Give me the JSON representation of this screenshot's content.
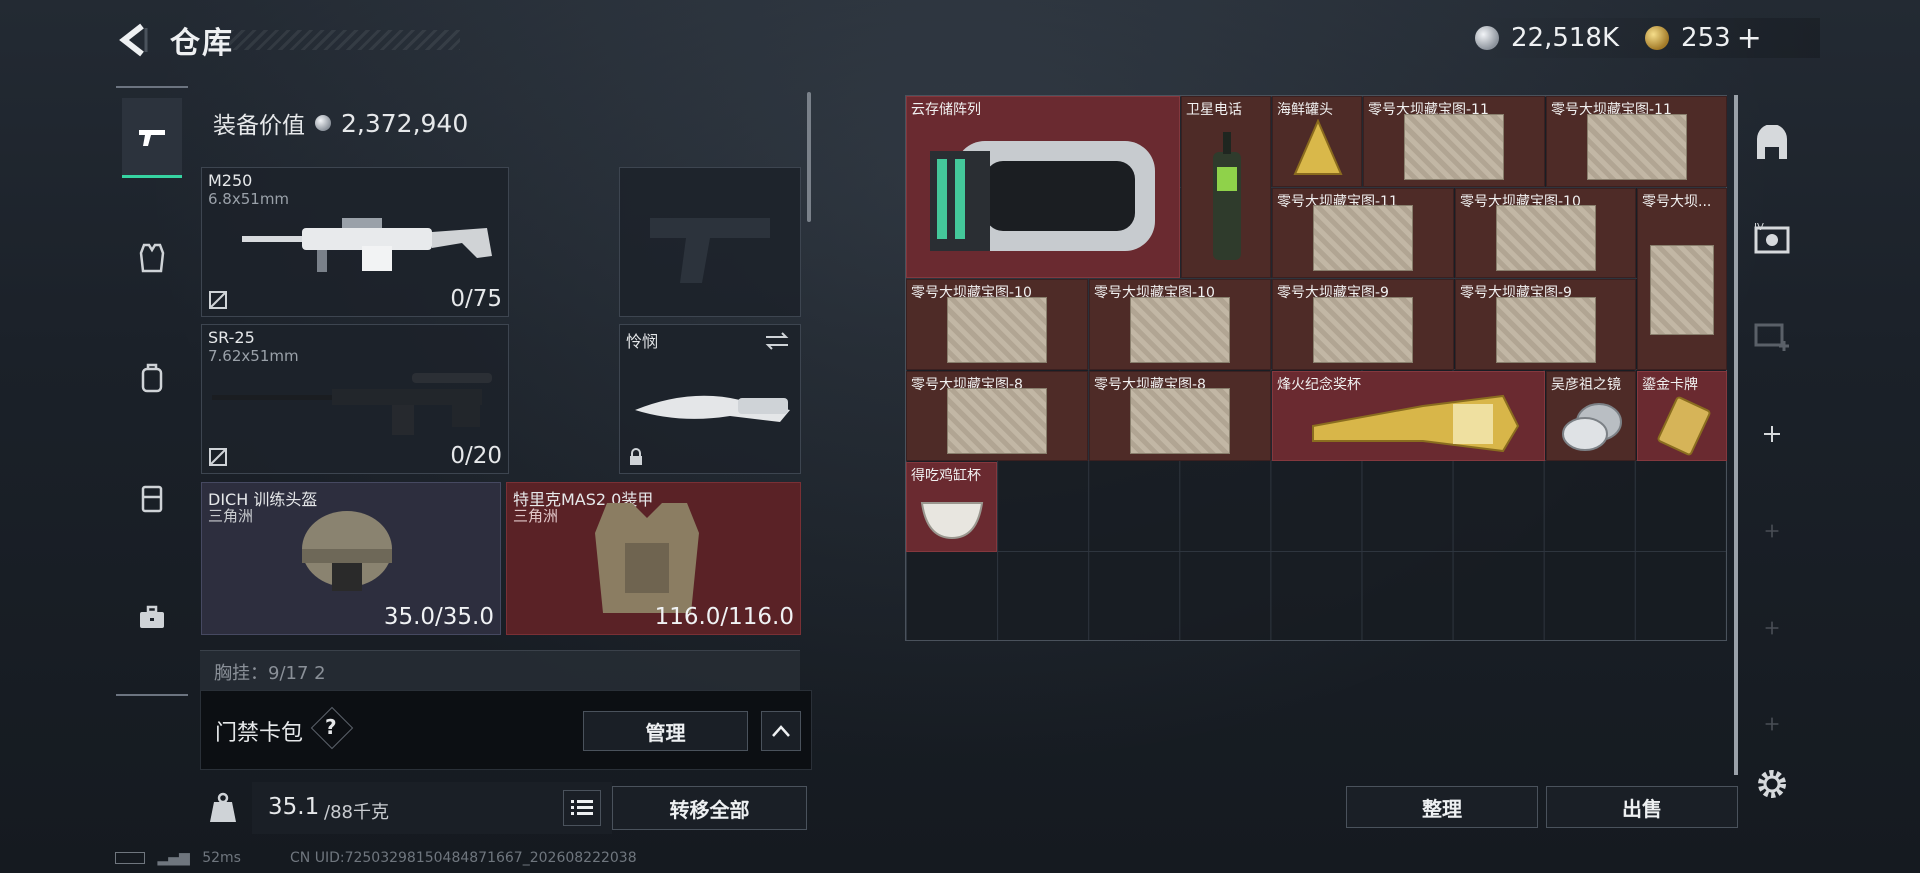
{
  "header": {
    "title": "仓库",
    "silver_amount": "22,518K",
    "gold_amount": "253",
    "gold_add_label": "+"
  },
  "colors": {
    "accent": "#36d4a2",
    "rarity_red": "#6a2a30",
    "rarity_purple": "#2d2e3e"
  },
  "nav": {
    "items": [
      {
        "icon": "pistol-icon",
        "active": true
      },
      {
        "icon": "vest-icon",
        "active": false
      },
      {
        "icon": "backpack-icon",
        "active": false
      },
      {
        "icon": "chest-rig-icon",
        "active": false
      },
      {
        "icon": "briefcase-icon",
        "active": false
      }
    ]
  },
  "loadout": {
    "value_label": "装备价值",
    "value_amount": "2,372,940",
    "primary": {
      "name": "M250",
      "caliber": "6.8x51mm",
      "ammo": "0/75"
    },
    "secondary": {
      "name": "SR-25",
      "caliber": "7.62x51mm",
      "ammo": "0/20"
    },
    "melee": {
      "name": "怜悯"
    },
    "helmet": {
      "name": "DICH 训练头盔",
      "faction": "三角洲",
      "durability": "35.0/35.0"
    },
    "armor": {
      "name": "特里克MAS2.0装甲",
      "faction": "三角洲",
      "durability": "116.0/116.0"
    },
    "chest_rig_peek": "胸挂：9/17   2"
  },
  "card_wallet": {
    "label": "门禁卡包",
    "help": "?",
    "manage_label": "管理"
  },
  "weight": {
    "value": "35.1",
    "capacity": "/88千克",
    "transfer_all_label": "转移全部"
  },
  "stash": {
    "items": [
      {
        "name": "云存储阵列"
      },
      {
        "name": "卫星电话"
      },
      {
        "name": "海鲜罐头"
      },
      {
        "name": "零号大坝藏宝图-11"
      },
      {
        "name": "零号大坝藏宝图-11"
      },
      {
        "name": "零号大坝藏宝图-11"
      },
      {
        "name": "零号大坝藏宝图-10"
      },
      {
        "name": "零号大坝..."
      },
      {
        "name": "零号大坝藏宝图-10"
      },
      {
        "name": "零号大坝藏宝图-10"
      },
      {
        "name": "零号大坝藏宝图-9"
      },
      {
        "name": "零号大坝藏宝图-9"
      },
      {
        "name": "零号大坝藏宝图-8"
      },
      {
        "name": "零号大坝藏宝图-8"
      },
      {
        "name": "烽火纪念奖杯"
      },
      {
        "name": "吴彦祖之镜"
      },
      {
        "name": "鎏金卡牌"
      },
      {
        "name": "得吃鸡缸杯"
      }
    ],
    "sort_label": "整理",
    "sell_label": "出售"
  },
  "status": {
    "ping": "52ms",
    "uid": "CN UID:72503298150484871667_202608222038"
  }
}
